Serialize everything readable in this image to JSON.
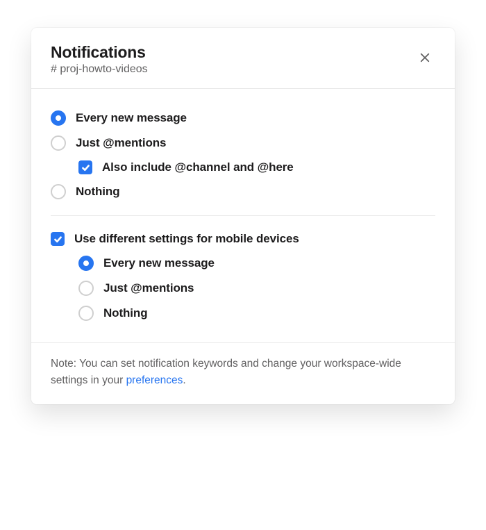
{
  "header": {
    "title": "Notifications",
    "channel_prefix": "#",
    "channel_name": "proj-howto-videos"
  },
  "desktop": {
    "options": {
      "every": "Every new message",
      "mentions": "Just @mentions",
      "include_channel": "Also include @channel and @here",
      "nothing": "Nothing"
    }
  },
  "mobile": {
    "use_different": "Use different settings for mobile devices",
    "options": {
      "every": "Every new message",
      "mentions": "Just @mentions",
      "nothing": "Nothing"
    }
  },
  "footer": {
    "note_prefix": "Note: You can set notification keywords and change your workspace-wide settings in your ",
    "link": "preferences",
    "note_suffix": "."
  }
}
